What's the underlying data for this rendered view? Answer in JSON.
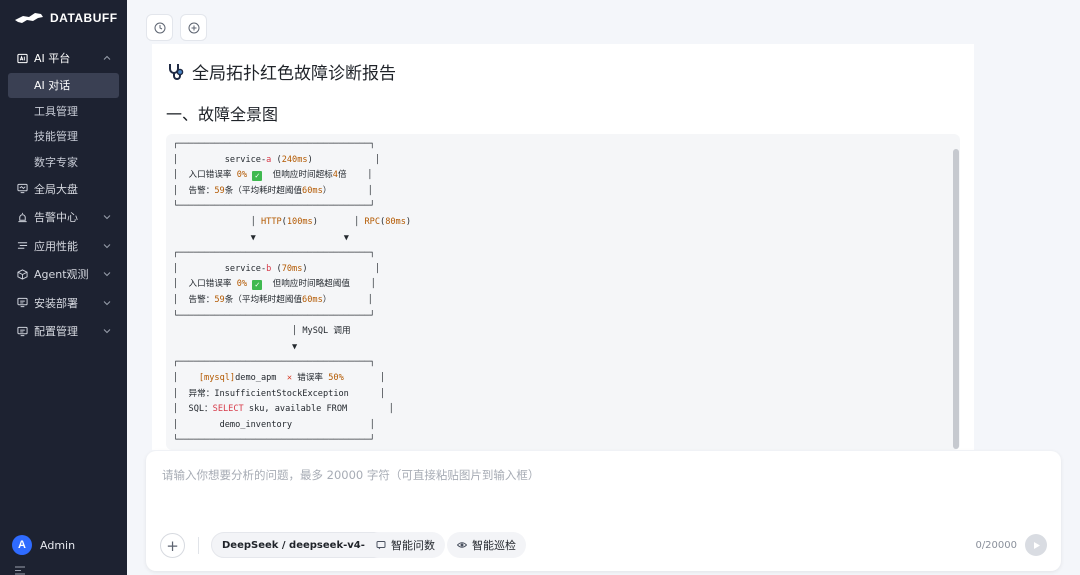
{
  "brand": {
    "logo_text": "DATABUFF"
  },
  "sidebar": {
    "group_ai": {
      "label": "AI 平台",
      "icon": "ai-platform-icon"
    },
    "sub_items": [
      {
        "label": "AI 对话",
        "active": true
      },
      {
        "label": "工具管理",
        "active": false
      },
      {
        "label": "技能管理",
        "active": false
      },
      {
        "label": "数字专家",
        "active": false
      }
    ],
    "items": [
      {
        "label": "全局大盘",
        "icon": "dashboard-icon",
        "has_children": false
      },
      {
        "label": "告警中心",
        "icon": "alarm-icon",
        "has_children": true
      },
      {
        "label": "应用性能",
        "icon": "apm-icon",
        "has_children": true
      },
      {
        "label": "Agent观测",
        "icon": "agent-icon",
        "has_children": true
      },
      {
        "label": "安装部署",
        "icon": "install-icon",
        "has_children": true
      },
      {
        "label": "配置管理",
        "icon": "config-icon",
        "has_children": true
      }
    ],
    "user": {
      "initial": "A",
      "name": "Admin"
    }
  },
  "toolbar": {
    "history_icon": "history-icon",
    "new_chat_icon": "new-chat-icon"
  },
  "report": {
    "title": "全局拓扑红色故障诊断报告",
    "section_title": "一、故障全景图",
    "diagram": {
      "service_a": {
        "header_name": "service-",
        "header_suffix": "a",
        "header_latency": "240ms",
        "line1_prefix": "入口错误率",
        "line1_rate": "0%",
        "line1_suffix": "但响应时间超标",
        "line1_times": "4",
        "line1_times_unit": "倍",
        "line2_prefix": "告警：",
        "line2_count": "59",
        "line2_mid": "条（平均耗时超阈值",
        "line2_val": "60ms",
        "line2_end": "）"
      },
      "edge_a_b": {
        "left_label": "HTTP",
        "left_latency": "100ms",
        "right_label": "RPC",
        "right_latency": "80ms"
      },
      "service_b": {
        "header_name": "service-",
        "header_suffix": "b",
        "header_latency": "70ms",
        "line1_prefix": "入口错误率",
        "line1_rate": "0%",
        "line1_suffix": "但响应时间略超阈值",
        "line2_prefix": "告警：",
        "line2_count": "59",
        "line2_mid": "条（平均耗时超阈值",
        "line2_val": "60ms",
        "line2_end": "）"
      },
      "edge_b_db": {
        "label": "MySQL 调用"
      },
      "database": {
        "tag": "[mysql]",
        "name": "demo_apm",
        "error_label": "错误率",
        "error_rate": "50%",
        "exception_label": "异常：",
        "exception": "InsufficientStockException",
        "sql_label": "SQL：",
        "sql_keyword": "SELECT",
        "sql_rest": "sku, available FROM",
        "sql_table": "demo_inventory"
      }
    }
  },
  "composer": {
    "placeholder": "请输入你想要分析的问题，最多 20000 字符（可直接粘贴图片到输入框）",
    "model": "DeepSeek / deepseek-v4-",
    "chip_ask": "智能问数",
    "chip_patrol": "智能巡检",
    "counter": "0/20000"
  }
}
